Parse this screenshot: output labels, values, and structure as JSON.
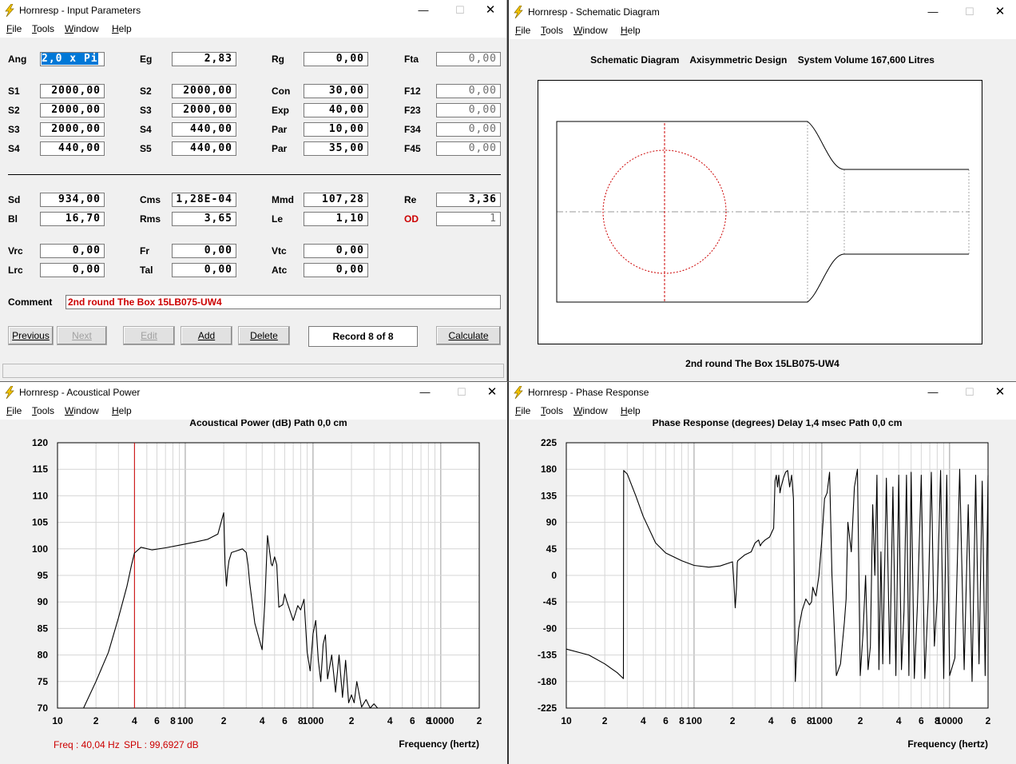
{
  "input_win": {
    "title": "Hornresp - Input Parameters",
    "menu": [
      "File",
      "Tools",
      "Window",
      "Help"
    ],
    "rows1": [
      [
        {
          "l": "Ang",
          "v": "2,0 x Pi",
          "sel": true
        },
        {
          "l": "Eg",
          "v": "2,83"
        },
        {
          "l": "Rg",
          "v": "0,00"
        },
        {
          "l": "Fta",
          "v": "0,00",
          "gray": true
        }
      ]
    ],
    "rows2": [
      [
        {
          "l": "S1",
          "v": "2000,00"
        },
        {
          "l": "S2",
          "v": "2000,00"
        },
        {
          "l": "Con",
          "v": "30,00"
        },
        {
          "l": "F12",
          "v": "0,00",
          "gray": true
        }
      ],
      [
        {
          "l": "S2",
          "v": "2000,00"
        },
        {
          "l": "S3",
          "v": "2000,00"
        },
        {
          "l": "Exp",
          "v": "40,00"
        },
        {
          "l": "F23",
          "v": "0,00",
          "gray": true
        }
      ],
      [
        {
          "l": "S3",
          "v": "2000,00"
        },
        {
          "l": "S4",
          "v": "440,00"
        },
        {
          "l": "Par",
          "v": "10,00"
        },
        {
          "l": "F34",
          "v": "0,00",
          "gray": true
        }
      ],
      [
        {
          "l": "S4",
          "v": "440,00"
        },
        {
          "l": "S5",
          "v": "440,00"
        },
        {
          "l": "Par",
          "v": "35,00"
        },
        {
          "l": "F45",
          "v": "0,00",
          "gray": true
        }
      ]
    ],
    "rows3": [
      [
        {
          "l": "Sd",
          "v": "934,00"
        },
        {
          "l": "Cms",
          "v": "1,28E-04"
        },
        {
          "l": "Mmd",
          "v": "107,28"
        },
        {
          "l": "Re",
          "v": "3,36"
        }
      ],
      [
        {
          "l": "Bl",
          "v": "16,70"
        },
        {
          "l": "Rms",
          "v": "3,65"
        },
        {
          "l": "Le",
          "v": "1,10"
        },
        {
          "l": "OD",
          "v": "1",
          "gray": true,
          "red": true
        }
      ]
    ],
    "rows4": [
      [
        {
          "l": "Vrc",
          "v": "0,00"
        },
        {
          "l": "Fr",
          "v": "0,00"
        },
        {
          "l": "Vtc",
          "v": "0,00"
        }
      ],
      [
        {
          "l": "Lrc",
          "v": "0,00"
        },
        {
          "l": "Tal",
          "v": "0,00"
        },
        {
          "l": "Atc",
          "v": "0,00"
        }
      ]
    ],
    "comment_label": "Comment",
    "comment_value": "2nd round The Box 15LB075-UW4",
    "buttons": {
      "previous": "Previous",
      "next": "Next",
      "edit": "Edit",
      "add": "Add",
      "delete": "Delete",
      "calculate": "Calculate"
    },
    "record": "Record 8 of 8"
  },
  "schematic_win": {
    "title": "Hornresp - Schematic Diagram",
    "menu": [
      "File",
      "Tools",
      "Window",
      "Help"
    ],
    "heading": "Schematic Diagram    Axisymmetric Design    System Volume 167,600 Litres",
    "footer": "2nd round The Box 15LB075-UW4"
  },
  "power_win": {
    "title": "Hornresp - Acoustical Power",
    "menu": [
      "File",
      "Tools",
      "Window",
      "Help"
    ],
    "heading": "Acoustical Power (dB)    Path 0,0 cm",
    "cursor_freq": "Freq : 40,04 Hz",
    "cursor_spl": "SPL : 99,6927 dB",
    "xlabel": "Frequency (hertz)"
  },
  "phase_win": {
    "title": "Hornresp - Phase Response",
    "menu": [
      "File",
      "Tools",
      "Window",
      "Help"
    ],
    "heading": "Phase Response (degrees)    Delay 1,4 msec    Path 0,0 cm",
    "xlabel": "Frequency (hertz)"
  },
  "chart_data": [
    {
      "type": "line",
      "title": "Acoustical Power (dB)    Path 0,0 cm",
      "xlabel": "Frequency (hertz)",
      "ylabel": "",
      "xscale": "log",
      "xlim": [
        10,
        20000
      ],
      "ylim": [
        70,
        120
      ],
      "yticks": [
        120,
        115,
        110,
        105,
        100,
        95,
        90,
        85,
        80,
        75,
        70
      ],
      "xtick_labels": [
        "10",
        "2",
        "4",
        "6",
        "8",
        "100",
        "2",
        "4",
        "6",
        "8",
        "1000",
        "2",
        "4",
        "6",
        "8",
        "10000",
        "2"
      ],
      "cursor_x": 40.04,
      "series": [
        {
          "x": [
            16,
            20,
            25,
            30,
            35,
            38,
            40,
            45,
            55,
            70,
            90,
            120,
            150,
            180,
            200,
            205,
            210,
            215,
            220,
            230,
            250,
            280,
            300,
            310,
            320,
            350,
            400,
            420,
            440,
            460,
            470,
            480,
            500,
            520,
            540,
            580,
            600,
            620,
            700,
            760,
            800,
            850,
            900,
            950,
            1000,
            1050,
            1100,
            1150,
            1200,
            1250,
            1300,
            1400,
            1500,
            1600,
            1700,
            1800,
            1900,
            2000,
            2100,
            2200,
            2400,
            2600,
            2800,
            3000,
            3200
          ],
          "y": [
            70,
            75,
            80.5,
            87,
            93,
            97,
            99.2,
            100.3,
            99.8,
            100.2,
            100.7,
            101.3,
            101.8,
            102.8,
            106.8,
            97,
            93,
            96,
            97.8,
            99.3,
            99.6,
            100,
            99.3,
            97,
            93.5,
            86,
            81,
            90,
            102.5,
            99,
            97.2,
            96.8,
            98.5,
            97,
            89,
            89.5,
            91.5,
            90.3,
            86.5,
            89.3,
            88.5,
            90.5,
            80.5,
            77,
            84,
            86.5,
            79,
            75,
            82,
            83.8,
            75.5,
            80,
            73,
            80,
            72,
            79,
            71,
            72.5,
            71,
            75,
            70.2,
            71.6,
            70,
            70.8,
            70
          ]
        }
      ]
    },
    {
      "type": "line",
      "title": "Phase Response (degrees)    Delay 1,4 msec    Path 0,0 cm",
      "xlabel": "Frequency (hertz)",
      "ylabel": "",
      "xscale": "log",
      "xlim": [
        10,
        20000
      ],
      "ylim": [
        -225,
        225
      ],
      "yticks": [
        225,
        180,
        135,
        90,
        45,
        0,
        -45,
        -90,
        -135,
        -180,
        -225
      ],
      "xtick_labels": [
        "10",
        "2",
        "4",
        "6",
        "8",
        "100",
        "2",
        "4",
        "6",
        "8",
        "1000",
        "2",
        "4",
        "6",
        "8",
        "10000",
        "2"
      ],
      "series": [
        {
          "x": [
            10,
            15,
            20,
            25,
            28,
            28.1,
            30,
            35,
            40,
            50,
            60,
            80,
            100,
            130,
            160,
            200,
            205,
            210,
            215,
            218,
            220,
            250,
            280,
            300,
            320,
            330,
            340,
            360,
            390,
            420,
            430,
            440,
            450,
            460,
            470,
            480,
            500,
            520,
            540,
            560,
            580,
            600,
            620,
            640,
            650,
            660,
            700,
            750,
            800,
            830,
            850,
            880,
            900,
            950,
            1000,
            1050,
            1100,
            1150,
            1200,
            1300,
            1400,
            1500,
            1550,
            1600,
            1700,
            1800,
            1900,
            2000,
            2100,
            2200,
            2300,
            2400,
            2500,
            2600,
            2700,
            2800,
            2900,
            3000,
            3200,
            3400,
            3600,
            3800,
            4000,
            4200,
            4400,
            4600,
            4800,
            5000,
            5300,
            5600,
            6000,
            6400,
            6800,
            7200,
            7600,
            8000,
            8500,
            9000,
            9500,
            10000,
            11000,
            12000,
            13000,
            14000,
            15000,
            16000,
            17000,
            18000,
            19000,
            20000
          ],
          "y": [
            -125,
            -135,
            -150,
            -165,
            -175,
            178,
            172,
            135,
            100,
            55,
            38,
            25,
            17,
            14,
            16,
            23,
            -12,
            -55,
            -20,
            22,
            25,
            35,
            40,
            55,
            60,
            50,
            55,
            60,
            65,
            80,
            160,
            170,
            150,
            170,
            140,
            150,
            165,
            175,
            178,
            150,
            170,
            130,
            -180,
            -120,
            -110,
            -90,
            -60,
            -40,
            -50,
            -45,
            -20,
            -30,
            -35,
            0,
            60,
            130,
            140,
            175,
            0,
            -170,
            -150,
            -80,
            -40,
            90,
            40,
            150,
            180,
            -170,
            -100,
            0,
            -160,
            -120,
            120,
            0,
            170,
            -160,
            40,
            -150,
            165,
            -150,
            150,
            -170,
            170,
            -160,
            -60,
            170,
            -170,
            175,
            -175,
            -50,
            170,
            -175,
            -40,
            175,
            -120,
            -40,
            178,
            -175,
            170,
            -170,
            -140,
            180,
            -160,
            120,
            -180,
            170,
            -150,
            160,
            -170,
            170
          ]
        }
      ]
    }
  ]
}
